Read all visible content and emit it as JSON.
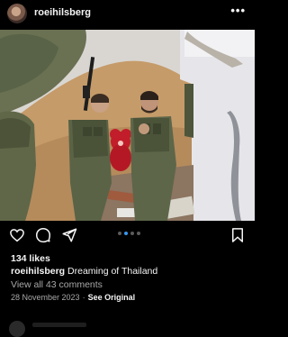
{
  "post": {
    "username": "roeihilsberg",
    "likes": "134 likes",
    "caption_user": "roeihilsberg",
    "caption_text": "Dreaming of Thailand",
    "view_comments": "View all 43 comments",
    "date": "28 November 2023",
    "separator": "·",
    "see_original": "See Original"
  },
  "carousel": {
    "count": 4,
    "active_index": 1
  },
  "icons": {
    "more": "more-options-icon",
    "like": "heart-icon",
    "comment": "comment-icon",
    "share": "share-icon",
    "save": "bookmark-icon"
  },
  "colors": {
    "background": "#000000",
    "accent": "#3897f0",
    "muted": "#a8a8a8"
  }
}
